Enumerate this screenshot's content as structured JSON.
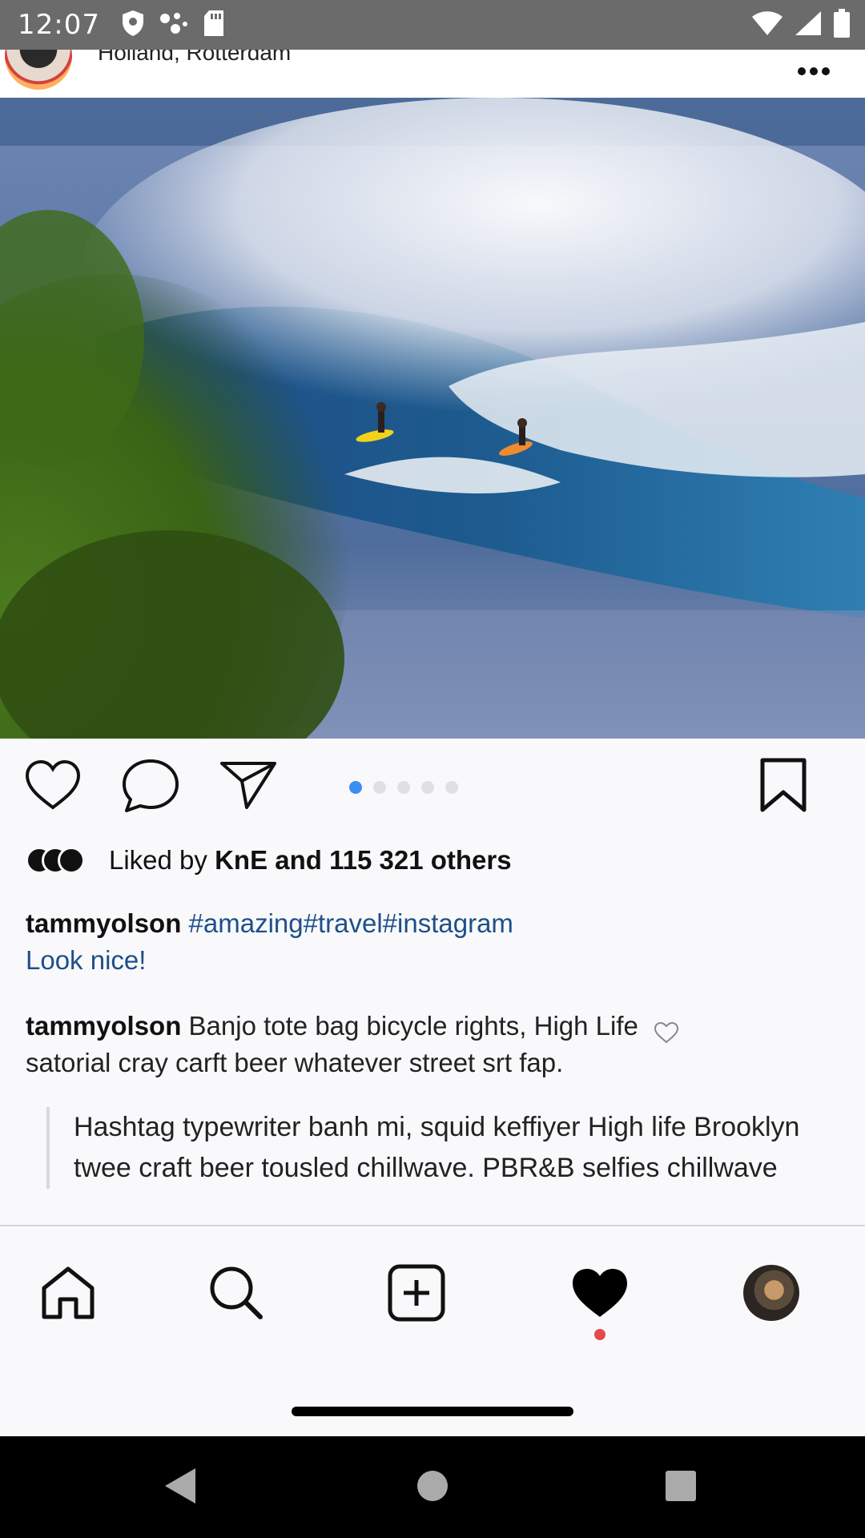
{
  "status_bar": {
    "time": "12:07",
    "icons": [
      "shield-icon",
      "dots-icon",
      "sd-card-icon",
      "wifi-icon",
      "signal-icon",
      "battery-icon"
    ]
  },
  "post": {
    "location": "Holland, Rotterdam",
    "photo_icon": "surfing-wave-photo",
    "carousel": {
      "total": 5,
      "active_index": 0
    },
    "likes": {
      "prefix": "Liked by ",
      "bold": "KnE and 115 321 others"
    },
    "caption": {
      "username": "tammyolson",
      "hashtags": "#amazing#travel#instagram",
      "line2": "Look nice!"
    },
    "comment": {
      "username": "tammyolson",
      "text": "Banjo tote bag bicycle rights, High Life",
      "text2": "satorial cray carft beer whatever street srt fap."
    },
    "quote": "Hashtag typewriter banh mi, squid keffiyer High life Brooklyn twee craft beer tousled chillwave. PBR&B selfies chillwave"
  },
  "bottom_nav": {
    "items": [
      "home-icon",
      "search-icon",
      "add-post-icon",
      "heart-icon",
      "profile-avatar"
    ],
    "active": "heart-icon",
    "notification_color": "#e5484d"
  },
  "colors": {
    "accent_blue": "#3b8ff0",
    "hashtag": "#1d4f8a",
    "status_bar": "#6b6b6b"
  }
}
